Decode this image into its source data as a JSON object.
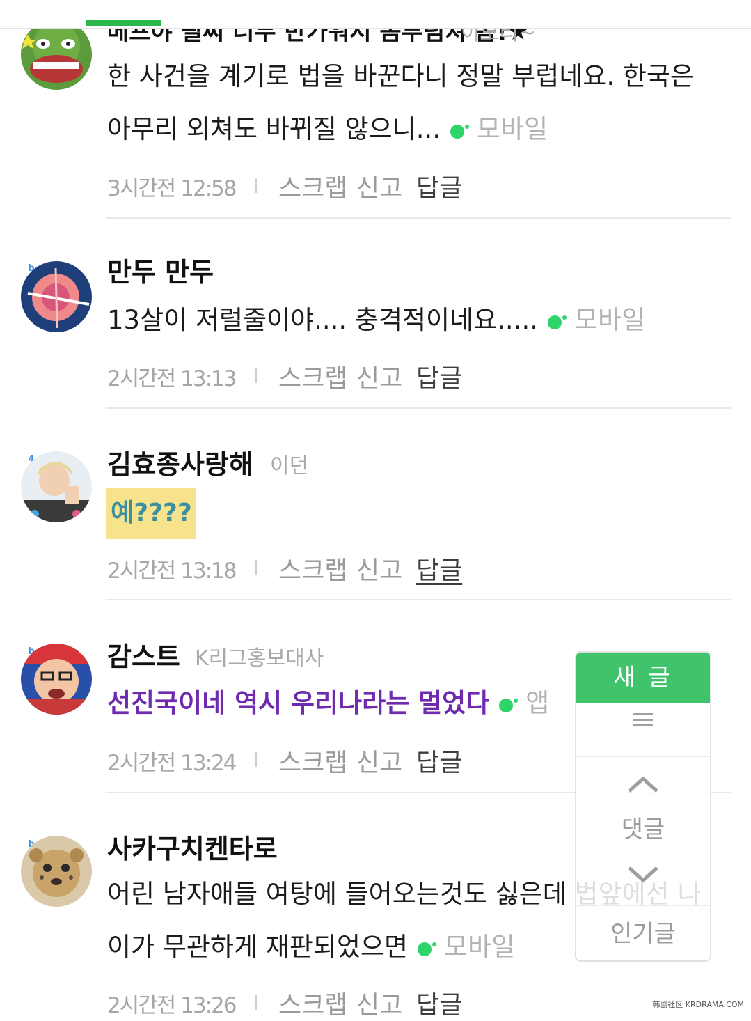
{
  "comments": [
    {
      "nickname": "베프야 될씨 너무 반가워서 몸부림쳐 봄!★",
      "tag": "이모티~",
      "text_lines": [
        "한 사건을 계기로 법을 바꾼다니 정말 부럽네요. 한국은",
        "아무리 외쳐도 바뀌질 않으니..."
      ],
      "source": "모바일",
      "time": "3시간전 12:58",
      "actions": {
        "scrap": "스크랩",
        "report": "신고",
        "reply": "답글"
      }
    },
    {
      "nickname": "만두 만두",
      "level": "b",
      "text_lines": [
        "13살이 저럴줄이야.... 충격적이네요....."
      ],
      "source": "모바일",
      "time": "2시간전 13:13",
      "actions": {
        "scrap": "스크랩",
        "report": "신고",
        "reply": "답글"
      }
    },
    {
      "nickname": "김효종사랑해",
      "level": "4",
      "tag": "이던",
      "sticker": "예????",
      "time": "2시간전 13:18",
      "actions": {
        "scrap": "스크랩",
        "report": "신고",
        "reply": "답글"
      }
    },
    {
      "nickname": "감스트",
      "level": "b",
      "tag": "K리그홍보대사",
      "text_lines": [
        "선진국이네 역시 우리나라는 멀었다"
      ],
      "source": "앱",
      "time": "2시간전 13:24",
      "actions": {
        "scrap": "스크랩",
        "report": "신고",
        "reply": "답글"
      }
    },
    {
      "nickname": "사카구치켄타로",
      "level": "b",
      "text_lines": [
        "어린 남자애들 여탕에 들어오는것도 싫은데 법앞에선 나",
        "이가 무관하게 재판되었으면"
      ],
      "source": "모바일",
      "time": "2시간전 13:26",
      "actions": {
        "scrap": "스크랩",
        "report": "신고",
        "reply": "답글"
      }
    }
  ],
  "floating_menu": {
    "new_post": "새 글",
    "comments": "댓글",
    "popular": "인기글"
  },
  "watermark": "韩剧社区 KRDRAMA.COM",
  "colors": {
    "accent_green": "#3fc46c",
    "purple_text": "#6e2bb0",
    "sticker_bg": "#f8e38d"
  },
  "icons": [
    "menu-icon",
    "chevron-up-icon",
    "chevron-down-icon",
    "mobile-dot-icon"
  ]
}
